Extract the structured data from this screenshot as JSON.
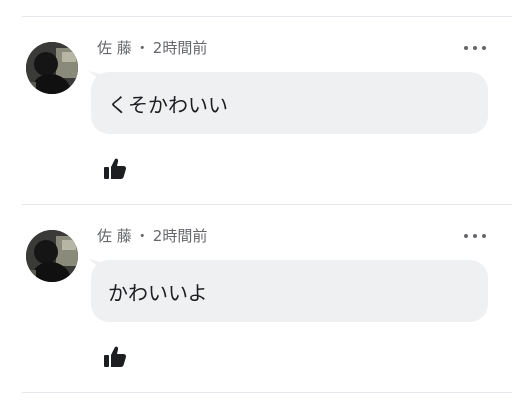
{
  "comments": [
    {
      "author": "佐 藤",
      "separator": "・",
      "time": "2時間前",
      "text": "くそかわいい",
      "avatar_icon": "user-avatar-photo",
      "more_icon": "more-horizontal-icon",
      "like_icon": "thumbs-up-icon"
    },
    {
      "author": "佐 藤",
      "separator": "・",
      "time": "2時間前",
      "text": "かわいいよ",
      "avatar_icon": "user-avatar-photo",
      "more_icon": "more-horizontal-icon",
      "like_icon": "thumbs-up-icon"
    }
  ],
  "colors": {
    "bubble_bg": "#eff0f2",
    "meta_text": "#65676b",
    "divider": "#e4e6eb",
    "icon": "#1c1e21"
  }
}
